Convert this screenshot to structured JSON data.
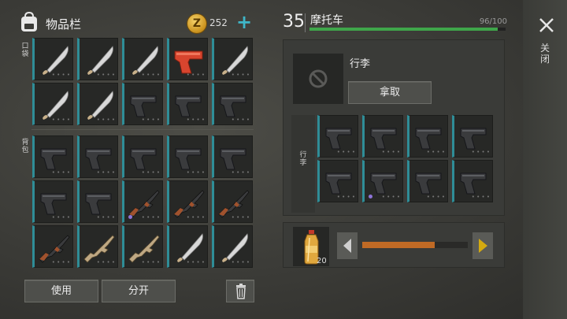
{
  "inventory": {
    "title": "物品栏",
    "currency": "252",
    "coin_symbol": "Z",
    "pockets_label": "口袋",
    "backpack_label": "背包",
    "pockets": [
      {
        "item": "machete-icon"
      },
      {
        "item": "machete-icon"
      },
      {
        "item": "machete-icon"
      },
      {
        "item": "flare-gun-icon"
      },
      {
        "item": "machete-icon"
      },
      {
        "item": "machete-icon"
      },
      {
        "item": "machete-icon"
      },
      {
        "item": "pistol-icon"
      },
      {
        "item": "pistol-icon"
      },
      {
        "item": "pistol-icon"
      }
    ],
    "backpack": [
      {
        "item": "pistol-icon"
      },
      {
        "item": "pistol-icon"
      },
      {
        "item": "pistol-icon"
      },
      {
        "item": "pistol-icon"
      },
      {
        "item": "pistol-icon"
      },
      {
        "item": "pistol-icon"
      },
      {
        "item": "pistol-icon"
      },
      {
        "item": "assault-rifle-icon"
      },
      {
        "item": "assault-rifle-icon"
      },
      {
        "item": "assault-rifle-icon"
      },
      {
        "item": "assault-rifle-icon"
      },
      {
        "item": "scar-rifle-icon"
      },
      {
        "item": "scar-rifle-icon"
      },
      {
        "item": "machete-icon"
      },
      {
        "item": "machete-icon"
      }
    ],
    "use_label": "使用",
    "split_label": "分开"
  },
  "vehicle": {
    "level": "35",
    "name": "摩托车",
    "durability_text": "96/100",
    "durability_fraction": 0.96,
    "luggage_label": "行李",
    "take_label": "拿取",
    "luggage_side_label": "行李",
    "luggage_items": [
      {
        "item": "pistol-icon"
      },
      {
        "item": "pistol-icon"
      },
      {
        "item": "pistol-icon"
      },
      {
        "item": "pistol-icon"
      },
      {
        "item": "pistol-icon"
      },
      {
        "item": "pistol-icon"
      },
      {
        "item": "pistol-icon"
      },
      {
        "item": "pistol-icon"
      }
    ]
  },
  "transfer": {
    "item": "water-bottle-icon",
    "count": "20",
    "fraction": 0.69
  },
  "close_label": "关闭",
  "colors": {
    "accent": "#2f8d97",
    "durability": "#3fa64a",
    "slider": "#c06a25",
    "arrow": "#c9a300"
  }
}
